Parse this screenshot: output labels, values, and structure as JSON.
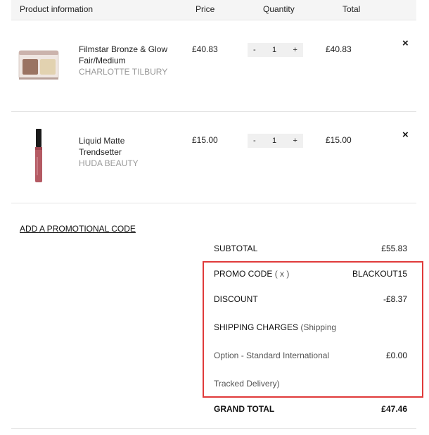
{
  "header": {
    "product_information": "Product information",
    "price": "Price",
    "quantity": "Quantity",
    "total": "Total"
  },
  "items": [
    {
      "name_line1": "Filmstar Bronze & Glow",
      "name_line2": "Fair/Medium",
      "brand": "CHARLOTTE TILBURY",
      "price": "£40.83",
      "quantity": "1",
      "total": "£40.83",
      "image_icon": "compact-palette-icon"
    },
    {
      "name_line1": "Liquid Matte",
      "name_line2": "Trendsetter",
      "brand": "HUDA BEAUTY",
      "price": "£15.00",
      "quantity": "1",
      "total": "£15.00",
      "image_icon": "lipstick-tube-icon"
    }
  ],
  "controls": {
    "minus": "-",
    "plus": "+",
    "remove": "×"
  },
  "promo_link": "ADD A PROMOTIONAL CODE",
  "summary": {
    "subtotal_label": "SUBTOTAL",
    "subtotal_value": "£55.83",
    "promo_label": "PROMO CODE",
    "promo_remove": "( x )",
    "promo_value": "BLACKOUT15",
    "discount_label": "DISCOUNT",
    "discount_value": "-£8.37",
    "shipping_label": "SHIPPING CHARGES",
    "shipping_line1": "(Shipping",
    "shipping_line2": "Option - Standard International",
    "shipping_line3": "Tracked Delivery)",
    "shipping_value": "£0.00",
    "grand_total_label": "GRAND TOTAL",
    "grand_total_value": "£47.46"
  },
  "colors": {
    "highlight_border": "#e03a3a",
    "header_bg": "#f5f5f5",
    "brand_text": "#999999"
  }
}
